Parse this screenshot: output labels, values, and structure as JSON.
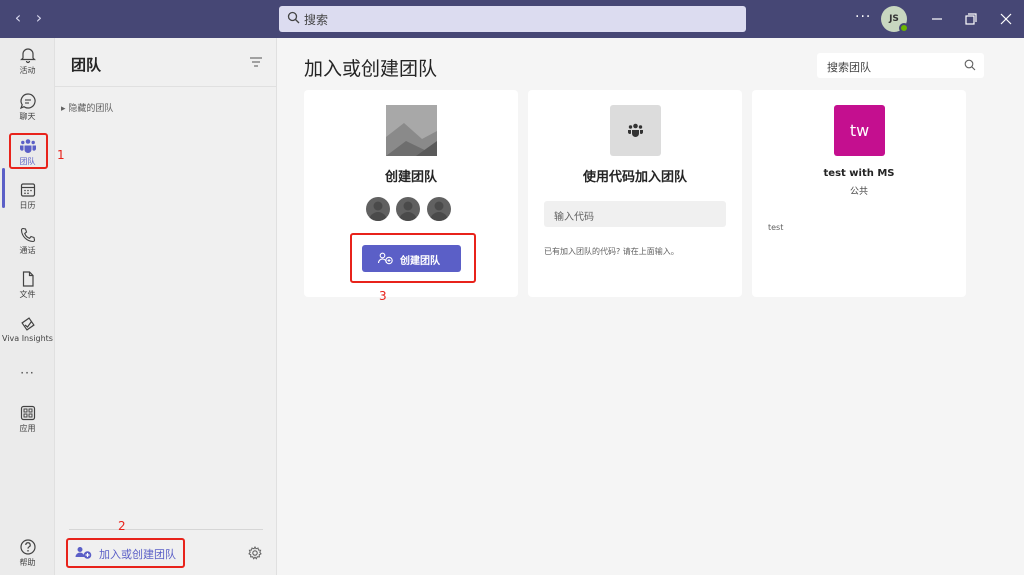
{
  "titlebar": {
    "search_placeholder": "搜索",
    "more_label": "···",
    "avatar_initials": "JS"
  },
  "rail": {
    "items": [
      {
        "label": "活动",
        "icon": "bell-icon"
      },
      {
        "label": "聊天",
        "icon": "chat-icon"
      },
      {
        "label": "团队",
        "icon": "teams-icon"
      },
      {
        "label": "日历",
        "icon": "calendar-icon"
      },
      {
        "label": "通话",
        "icon": "phone-icon"
      },
      {
        "label": "文件",
        "icon": "file-icon"
      },
      {
        "label": "Viva Insights",
        "icon": "insights-icon"
      },
      {
        "label": "···",
        "icon": "more-icon"
      },
      {
        "label": "应用",
        "icon": "apps-icon"
      },
      {
        "label": "帮助",
        "icon": "help-icon"
      }
    ]
  },
  "pane": {
    "title": "团队",
    "hidden_teams": "▸ 隐藏的团队",
    "join_create": "加入或创建团队"
  },
  "main": {
    "title": "加入或创建团队",
    "search_placeholder": "搜索团队",
    "card_create": {
      "title": "创建团队",
      "button": "创建团队"
    },
    "card_join": {
      "title": "使用代码加入团队",
      "input_placeholder": "输入代码",
      "hint": "已有加入团队的代码? 请在上面输入。"
    },
    "card_team": {
      "avatar": "tw",
      "name": "test with MS",
      "visibility": "公共",
      "description": "test"
    }
  },
  "annotations": {
    "n1": "1",
    "n2": "2",
    "n3": "3"
  },
  "colors": {
    "titlebar": "#464775",
    "accent": "#5b5fc7",
    "team_avatar": "#c40f8f",
    "annotation": "#e8231b"
  }
}
